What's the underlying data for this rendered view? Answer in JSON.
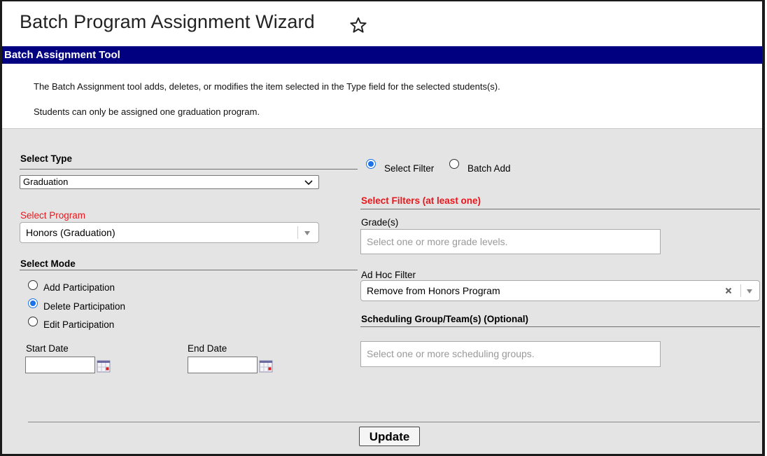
{
  "page_title": "Batch Program Assignment Wizard",
  "section_title": "Batch Assignment Tool",
  "info": {
    "line1": "The Batch Assignment tool adds, deletes, or modifies the item selected in the Type field for the selected students(s).",
    "line2": "Students can only be assigned one graduation program."
  },
  "left": {
    "select_type_label": "Select Type",
    "select_type_value": "Graduation",
    "select_program_label": "Select Program",
    "select_program_value": "Honors (Graduation)",
    "select_mode_label": "Select Mode",
    "modes": [
      {
        "label": "Add Participation",
        "selected": false
      },
      {
        "label": "Delete Participation",
        "selected": true
      },
      {
        "label": "Edit Participation",
        "selected": false
      }
    ],
    "start_date_label": "Start Date",
    "start_date_value": "",
    "end_date_label": "End Date",
    "end_date_value": ""
  },
  "right": {
    "filter_option_select": "Select Filter",
    "filter_option_batch": "Batch Add",
    "filter_mode_selected": "Select Filter",
    "filters_heading": "Select Filters (at least one)",
    "grades_label": "Grade(s)",
    "grades_placeholder": "Select one or more grade levels.",
    "adhoc_label": "Ad Hoc Filter",
    "adhoc_value": "Remove from Honors Program",
    "sched_heading": "Scheduling Group/Team(s) (Optional)",
    "sched_placeholder": "Select one or more scheduling groups."
  },
  "update_label": "Update",
  "icons": {
    "title": "star-outline-icon",
    "date": "calendar-icon",
    "clear": "clear-x-icon"
  },
  "colors": {
    "section_bar": "#000080",
    "required_label": "#e8161b",
    "radio_selected": "#1a73e8",
    "panel": "#e4e4e4"
  }
}
